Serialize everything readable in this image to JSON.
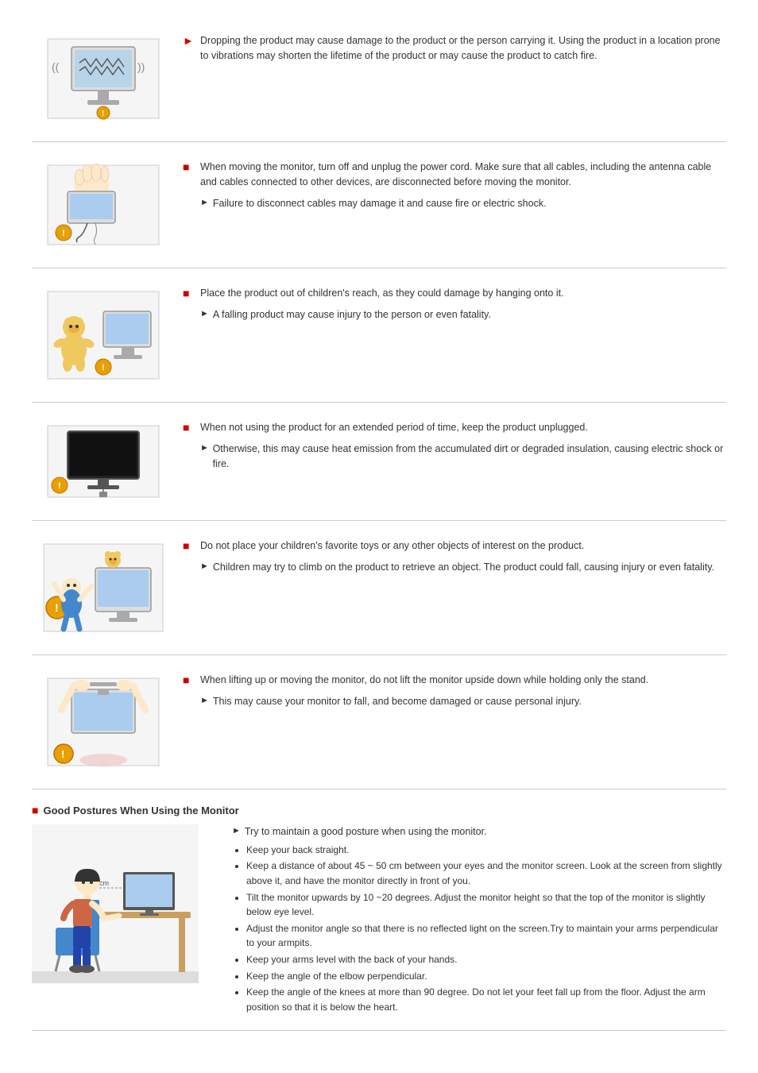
{
  "sections": [
    {
      "id": "vibration",
      "main_points": [
        "Dropping the product may cause damage to the product or the person carrying it. Using the product in a location prone to vibrations may shorten the lifetime of the product or may cause the product to catch fire."
      ],
      "sub_points": []
    },
    {
      "id": "moving",
      "main_points": [
        "When moving the monitor, turn off and unplug the power cord. Make sure that all cables, including the antenna cable and cables connected to other devices, are disconnected before moving the monitor."
      ],
      "sub_points": [
        "Failure to disconnect cables may damage it and cause fire or electric shock."
      ]
    },
    {
      "id": "children",
      "main_points": [
        "Place the product out of children's reach, as they could damage by hanging onto it."
      ],
      "sub_points": [
        "A falling product may cause injury to the person or even fatality."
      ]
    },
    {
      "id": "unplugged",
      "main_points": [
        "When not using the product for an extended period of time, keep the product unplugged."
      ],
      "sub_points": [
        "Otherwise, this may cause heat emission from the accumulated dirt or degraded insulation, causing electric shock or fire."
      ]
    },
    {
      "id": "toys",
      "main_points": [
        "Do not place your children's favorite toys or any other objects of interest on the product."
      ],
      "sub_points": [
        "Children may try to climb on the product to retrieve an object. The product could fall, causing injury or even fatality."
      ]
    },
    {
      "id": "lifting",
      "main_points": [
        "When lifting up or moving the monitor, do not lift the monitor upside down while holding only the stand."
      ],
      "sub_points": [
        "This may cause your monitor to fall, and become damaged or cause personal injury."
      ]
    }
  ],
  "good_postures": {
    "heading": "Good Postures When Using the Monitor",
    "intro": "Try to maintain a good posture when using the monitor.",
    "bullets": [
      "Keep your back straight.",
      "Keep a distance of about 45 ~ 50 cm between your eyes and the monitor screen. Look at the screen from slightly above it, and have the monitor directly in front of you.",
      "Tilt the monitor upwards by 10 ~20 degrees. Adjust the monitor height so that the top of the monitor is slightly below eye level.",
      "Adjust the monitor angle so that there is no reflected light on the screen.Try to maintain your arms perpendicular to your armpits.",
      "Keep your arms level with the back of your hands.",
      "Keep the angle of the elbow perpendicular.",
      "Keep the angle of the knees at more than 90 degree. Do not let your feet fall up from the floor. Adjust the arm position so that it is below the heart."
    ]
  }
}
